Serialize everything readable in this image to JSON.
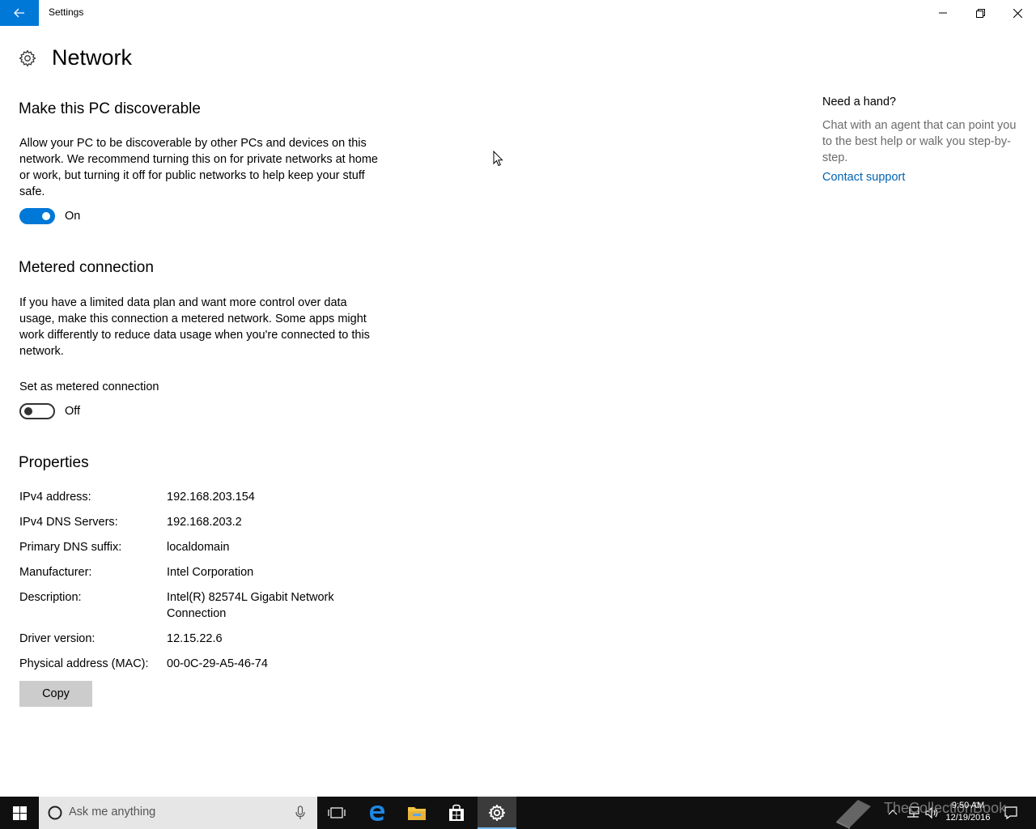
{
  "window": {
    "app_title": "Settings"
  },
  "page": {
    "title": "Network"
  },
  "discoverable": {
    "heading": "Make this PC discoverable",
    "description": "Allow your PC to be discoverable by other PCs and devices on this network. We recommend turning this on for private networks at home or work, but turning it off for public networks to help keep your stuff safe.",
    "toggle_state": "On",
    "toggle_on": true
  },
  "metered": {
    "heading": "Metered connection",
    "description": "If you have a limited data plan and want more control over data usage, make this connection a metered network. Some apps might work differently to reduce data usage when you're connected to this network.",
    "setting_label": "Set as metered connection",
    "toggle_state": "Off",
    "toggle_on": false
  },
  "properties": {
    "heading": "Properties",
    "rows": [
      {
        "label": "IPv4 address:",
        "value": "192.168.203.154"
      },
      {
        "label": "IPv4 DNS Servers:",
        "value": "192.168.203.2"
      },
      {
        "label": "Primary DNS suffix:",
        "value": "localdomain"
      },
      {
        "label": "Manufacturer:",
        "value": "Intel Corporation"
      },
      {
        "label": "Description:",
        "value": "Intel(R) 82574L Gigabit Network Connection"
      },
      {
        "label": "Driver version:",
        "value": "12.15.22.6"
      },
      {
        "label": "Physical address (MAC):",
        "value": "00-0C-29-A5-46-74"
      }
    ],
    "copy_label": "Copy"
  },
  "help": {
    "title": "Need a hand?",
    "text": "Chat with an agent that can point you to the best help or walk you step-by-step.",
    "link": "Contact support"
  },
  "taskbar": {
    "search_placeholder": "Ask me anything",
    "time": "9:50 AM",
    "date": "12/19/2016",
    "watermark": "TheCollectionBook"
  },
  "colors": {
    "accent": "#0078d7",
    "link": "#0063b1",
    "taskbar": "#101010"
  }
}
